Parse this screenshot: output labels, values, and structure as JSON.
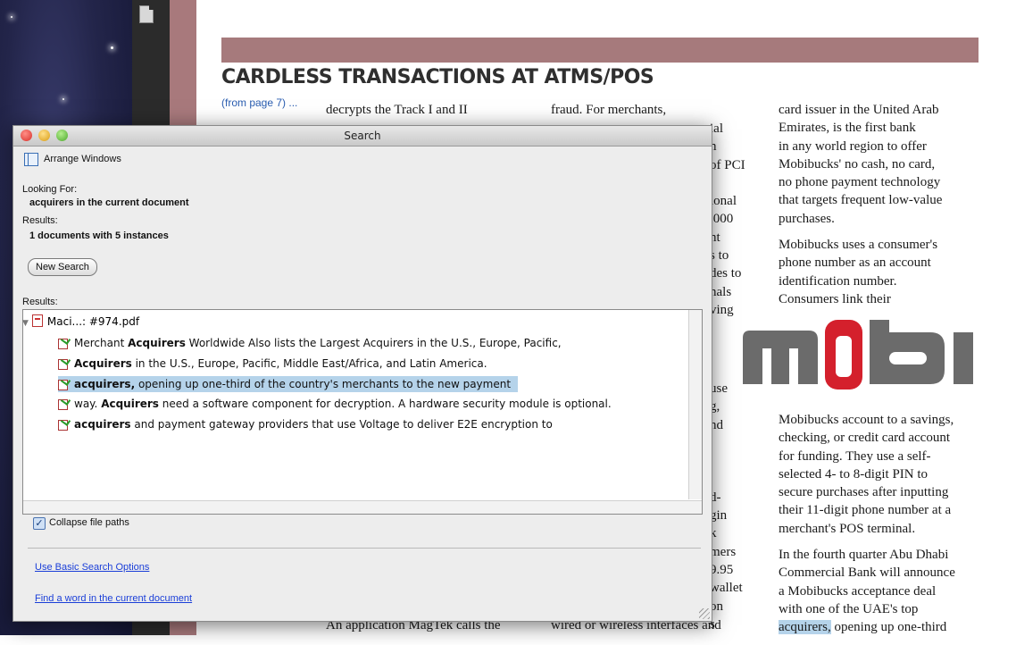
{
  "window": {
    "title": "Search",
    "arrange_label": "Arrange Windows",
    "looking_for_label": "Looking For:",
    "looking_for_value": "acquirers in the current document",
    "results_label": "Results:",
    "results_value": "1 documents with 5 instances",
    "new_search_label": "New Search",
    "results_list_label": "Results:",
    "file_name": "Maci...: #974.pdf",
    "hits": [
      {
        "term": "Acquirers",
        "before": "Merchant ",
        "after": " Worldwide Also lists the Largest Acquirers in the U.S., Europe, Pacific,"
      },
      {
        "term": "Acquirers",
        "before": "",
        "after": " in the U.S., Europe, Pacific, Middle East/Africa, and Latin America."
      },
      {
        "term": "acquirers,",
        "before": "",
        "after": " opening up one-third of the country's merchants to the new payment"
      },
      {
        "term": "Acquirers",
        "before": "way. ",
        "after": " need a software component for decryption. A hardware security module is optional."
      },
      {
        "term": "acquirers",
        "before": "",
        "after": " and payment gateway providers that use Voltage to deliver E2E encryption to"
      }
    ],
    "collapse_label": "Collapse file paths",
    "collapse_checked": true,
    "basic_options_link": "Use Basic Search Options",
    "find_word_link": "Find a word in the current document"
  },
  "document": {
    "headline": "CARDLESS TRANSACTIONS AT ATMS/POS",
    "from_page": "(from page 7) ...",
    "col1_top": "decrypts the Track I and II",
    "col1_bottom": "An application MagTek calls the",
    "col2_top": "fraud. For merchants,",
    "col2_bottom": "wired or wireless interfaces and",
    "col2_fragments": [
      "ial",
      "n",
      "of PCI",
      "",
      "ional",
      ",000",
      "nt",
      "s to",
      "des to",
      "nals",
      "ving"
    ],
    "col2_fragments_lower": [
      "use",
      "g,",
      "nd",
      "",
      "",
      "",
      "d-",
      "gin",
      "k",
      "mers",
      "9.95",
      "wallet",
      "on",
      "s"
    ],
    "col3_p1": [
      "card issuer in the United Arab",
      "Emirates, is the first bank",
      "in any world region to offer",
      "Mobibucks' no cash, no card,",
      "no phone payment technology",
      "that targets frequent low-value",
      "purchases."
    ],
    "col3_p2": [
      "Mobibucks uses a consumer's",
      "phone number as an account",
      "identification number.",
      "Consumers link their"
    ],
    "col3_p3": [
      "Mobibucks account to a savings,",
      "checking, or credit card account",
      "for funding. They use a self-",
      "selected 4- to 8-digit PIN to",
      "secure purchases after inputting",
      "their 11-digit phone number at a",
      "merchant's POS terminal."
    ],
    "col3_p4": [
      "In the fourth quarter Abu Dhabi",
      "Commercial Bank will announce",
      "a Mobibucks acceptance deal",
      "with one of the UAE's top"
    ],
    "col3_last_hl": "acquirers,",
    "col3_last_rest": " opening up one-third",
    "logo_text": "mobi"
  },
  "colors": {
    "banner": "#a67a7c",
    "selection": "#b5d3ea",
    "link": "#1a3ed8",
    "logo_grey": "#6b6b6b",
    "logo_red": "#d4202c"
  }
}
